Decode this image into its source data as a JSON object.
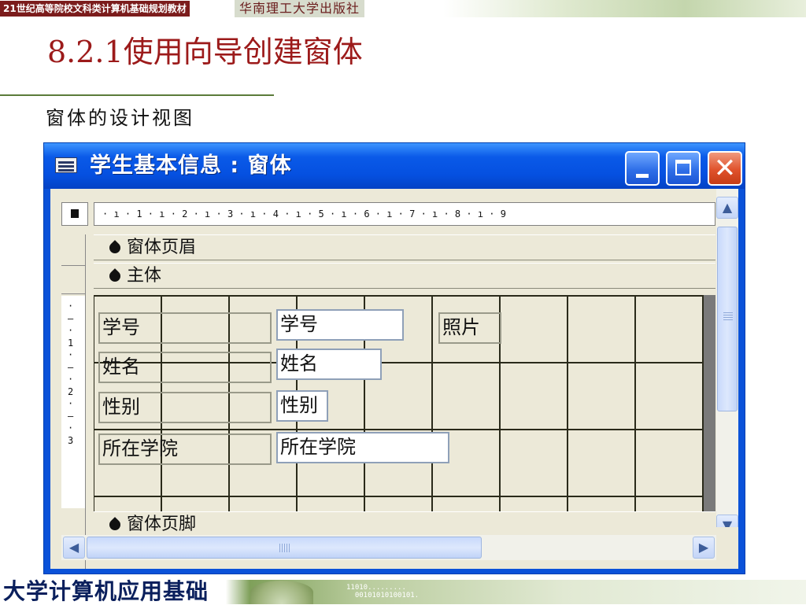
{
  "header": {
    "series_label": "21世纪高等院校文科类计算机基础规划教材",
    "publisher": "华南理工大学出版社"
  },
  "slide": {
    "title": "8.2.1使用向导创建窗体",
    "subtitle": "窗体的设计视图"
  },
  "window": {
    "title": "学生基本信息 : 窗体",
    "close_glyph": "✕"
  },
  "ruler": {
    "horizontal": "· ı · 1 · ı · 2 · ı · 3 · ı · 4 · ı · 5 · ı · 6 · ı · 7 · ı · 8 · ı · 9",
    "vertical": "·\n–\n·\n1\n·\n–\n·\n2\n·\n–\n·\n3"
  },
  "sections": {
    "header": "窗体页眉",
    "detail": "主体",
    "footer": "窗体页脚"
  },
  "controls": {
    "labels": [
      "学号",
      "姓名",
      "性别",
      "所在学院"
    ],
    "fields": [
      "学号",
      "姓名",
      "性别",
      "所在学院"
    ],
    "photo_label": "照片"
  },
  "scrollbar": {
    "up": "▲",
    "down": "▼",
    "left": "◀",
    "right": "▶"
  },
  "footer": {
    "course": "大学计算机应用基础",
    "binary": "11010.........\n  00101010100101."
  }
}
